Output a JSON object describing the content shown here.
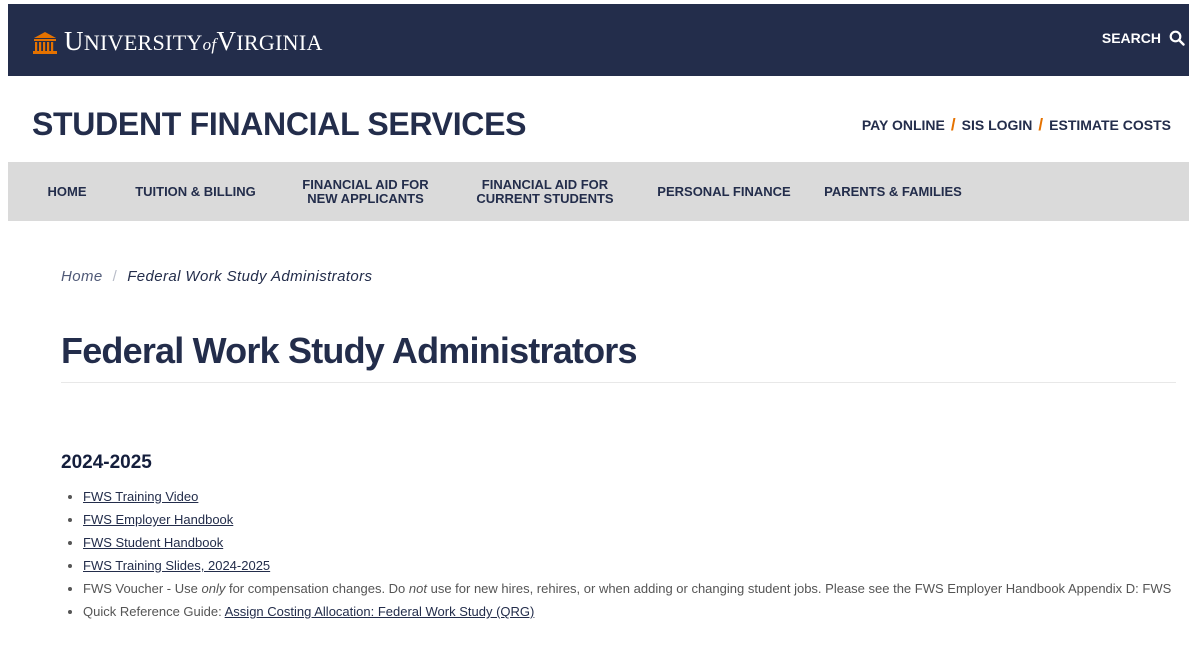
{
  "header": {
    "university": {
      "cap1": "U",
      "rest1": "NIVERSITY",
      "of": "of",
      "cap2": "V",
      "rest2": "IRGINIA"
    },
    "search_label": "SEARCH",
    "search_icon": "search-icon"
  },
  "site": {
    "title": "STUDENT FINANCIAL SERVICES",
    "quicklinks": [
      "PAY ONLINE",
      "SIS LOGIN",
      "ESTIMATE COSTS"
    ],
    "separator": "/"
  },
  "nav": {
    "items": [
      {
        "line1": "HOME",
        "line2": ""
      },
      {
        "line1": "TUITION & BILLING",
        "line2": ""
      },
      {
        "line1": "FINANCIAL AID FOR",
        "line2": "NEW APPLICANTS"
      },
      {
        "line1": "FINANCIAL AID FOR",
        "line2": "CURRENT STUDENTS"
      },
      {
        "line1": "PERSONAL FINANCE",
        "line2": ""
      },
      {
        "line1": "PARENTS & FAMILIES",
        "line2": ""
      }
    ]
  },
  "breadcrumb": {
    "home": "Home",
    "separator": "/",
    "current": "Federal Work Study Administrators"
  },
  "page": {
    "title": "Federal Work Study Administrators",
    "section_heading": "2024-2025",
    "links": [
      "FWS Training Video",
      "FWS Employer Handbook",
      "FWS Student Handbook",
      "FWS Training Slides, 2024-2025"
    ],
    "voucher": {
      "part1": "FWS Voucher - Use ",
      "only": "only",
      "part2": " for compensation changes. Do ",
      "not": "not",
      "part3": " use for new hires, rehires, or when adding or changing student jobs. Please see the FWS Employer Handbook Appendix D: FWS"
    },
    "qrg": {
      "prefix": "Quick Reference Guide: ",
      "link": "Assign Costing Allocation: Federal Work Study (QRG)"
    }
  },
  "colors": {
    "navy": "#232d4b",
    "orange": "#e57200",
    "nav_bg": "#dadada"
  }
}
